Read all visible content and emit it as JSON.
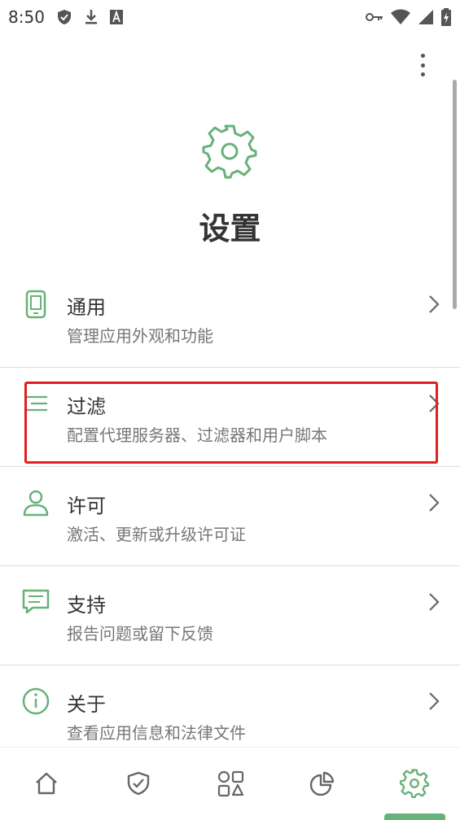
{
  "status_bar": {
    "time": "8:50",
    "left_icons": [
      "shield-check-icon",
      "download-icon",
      "font-a-icon"
    ],
    "right_icons": [
      "key-icon",
      "wifi-icon",
      "cell-signal-icon",
      "battery-icon"
    ]
  },
  "header": {
    "title": "设置",
    "icon": "gear-icon"
  },
  "colors": {
    "accent": "#67b279",
    "highlight": "#e02020",
    "text": "#333333",
    "subtext": "#777777"
  },
  "items": [
    {
      "title": "通用",
      "subtitle": "管理应用外观和功能",
      "icon": "phone-icon"
    },
    {
      "title": "过滤",
      "subtitle": "配置代理服务器、过滤器和用户脚本",
      "icon": "filter-lines-icon"
    },
    {
      "title": "许可",
      "subtitle": "激活、更新或升级许可证",
      "icon": "person-icon"
    },
    {
      "title": "支持",
      "subtitle": "报告问题或留下反馈",
      "icon": "chat-icon"
    },
    {
      "title": "关于",
      "subtitle": "查看应用信息和法律文件",
      "icon": "info-icon"
    }
  ],
  "bottom_nav": [
    {
      "icon": "home-icon",
      "active": false
    },
    {
      "icon": "shield-check-icon",
      "active": false
    },
    {
      "icon": "apps-grid-icon",
      "active": false
    },
    {
      "icon": "pie-chart-icon",
      "active": false
    },
    {
      "icon": "gear-icon",
      "active": true
    }
  ]
}
